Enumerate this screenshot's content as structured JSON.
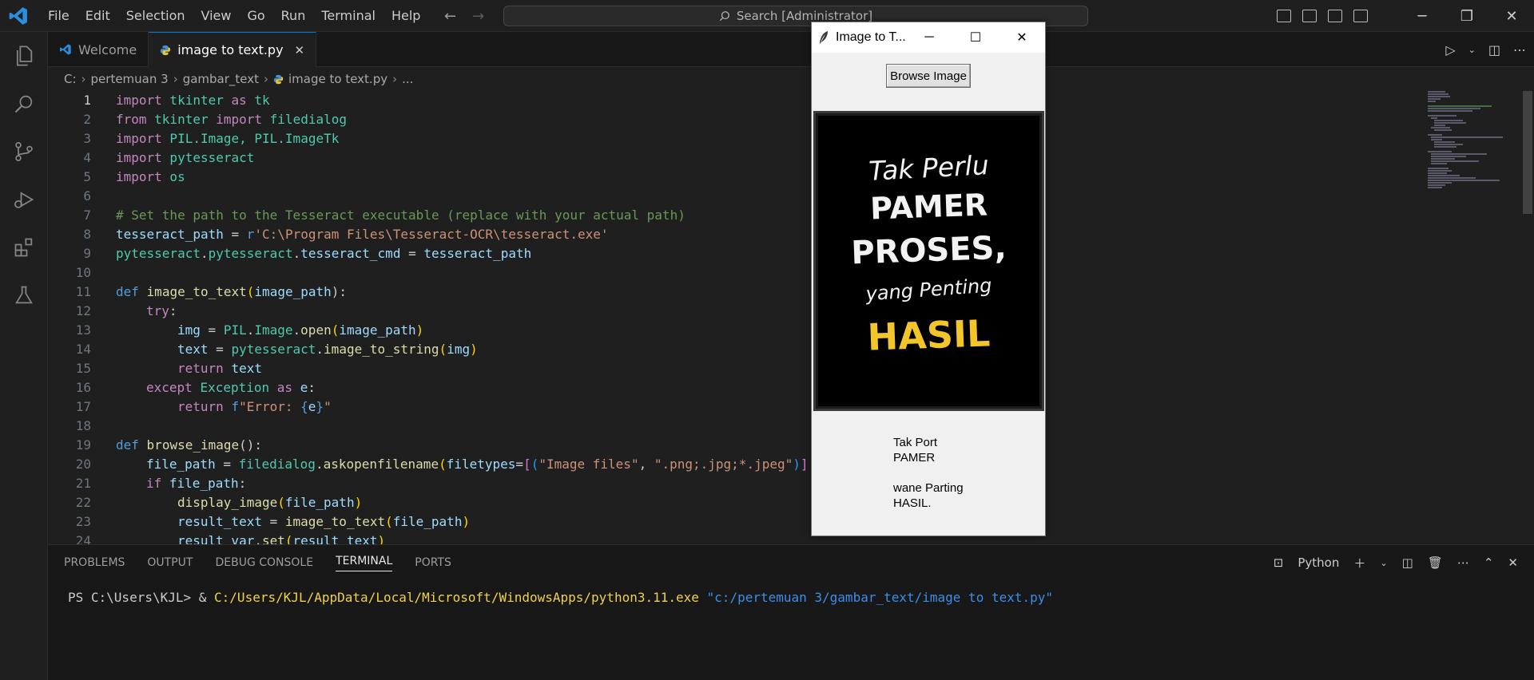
{
  "titlebar": {
    "menu": [
      "File",
      "Edit",
      "Selection",
      "View",
      "Go",
      "Run",
      "Terminal",
      "Help"
    ],
    "search": "Search [Administrator]"
  },
  "tabs": [
    {
      "label": "Welcome",
      "active": false
    },
    {
      "label": "image to text.py",
      "active": true
    }
  ],
  "breadcrumb": [
    "C:",
    "pertemuan 3",
    "gambar_text",
    "image to text.py",
    "..."
  ],
  "editor": {
    "current_line": 1,
    "lines": [
      {
        "n": "1"
      },
      {
        "n": "2"
      },
      {
        "n": "3"
      },
      {
        "n": "4"
      },
      {
        "n": "5"
      },
      {
        "n": "6"
      },
      {
        "n": "7"
      },
      {
        "n": "8"
      },
      {
        "n": "9"
      },
      {
        "n": "10"
      },
      {
        "n": "11"
      },
      {
        "n": "12"
      },
      {
        "n": "13"
      },
      {
        "n": "14"
      },
      {
        "n": "15"
      },
      {
        "n": "16"
      },
      {
        "n": "17"
      },
      {
        "n": "18"
      },
      {
        "n": "19"
      },
      {
        "n": "20"
      },
      {
        "n": "21"
      },
      {
        "n": "22"
      },
      {
        "n": "23"
      },
      {
        "n": "24"
      }
    ],
    "code": {
      "l1": [
        "import",
        " tkinter ",
        "as",
        " tk"
      ],
      "l2": [
        "from",
        " tkinter ",
        "import",
        " filedialog"
      ],
      "l3": [
        "import",
        " PIL.Image, PIL.ImageTk"
      ],
      "l4": [
        "import",
        " pytesseract"
      ],
      "l5": [
        "import",
        " os"
      ],
      "l7": "# Set the path to the Tesseract executable (replace with your actual path)",
      "l8": [
        "tesseract_path",
        " = ",
        "r",
        "'C:\\Program Files\\Tesseract-OCR\\tesseract.exe'"
      ],
      "l9": [
        "pytesseract",
        ".",
        "pytesseract",
        ".",
        "tesseract_cmd",
        " = ",
        "tesseract_path"
      ],
      "l11": [
        "def",
        " ",
        "image_to_text",
        "(",
        "image_path",
        "):"
      ],
      "l12": [
        "try",
        ":"
      ],
      "l13": [
        "img",
        " = ",
        "PIL",
        ".",
        "Image",
        ".",
        "open",
        "(",
        "image_path",
        ")"
      ],
      "l14": [
        "text",
        " = ",
        "pytesseract",
        ".",
        "image_to_string",
        "(",
        "img",
        ")"
      ],
      "l15": [
        "return",
        " ",
        "text"
      ],
      "l16": [
        "except",
        " ",
        "Exception",
        " ",
        "as",
        " ",
        "e",
        ":"
      ],
      "l17": [
        "return",
        " ",
        "f",
        "\"Error: ",
        "{",
        "e",
        "}",
        "\""
      ],
      "l19": [
        "def",
        " ",
        "browse_image",
        "():"
      ],
      "l20": [
        "file_path",
        " = ",
        "filedialog",
        ".",
        "askopenfilename",
        "(",
        "filetypes",
        "=",
        "[",
        "(",
        "\"Image files\"",
        ", ",
        "\".png;.jpg;*.jpeg\"",
        ")",
        "]"
      ],
      "l21": [
        "if",
        " ",
        "file_path",
        ":"
      ],
      "l22": [
        "display_image",
        "(",
        "file_path",
        ")"
      ],
      "l23": [
        "result_text",
        " = ",
        "image_to_text",
        "(",
        "file_path",
        ")"
      ],
      "l24": [
        "result_var",
        ".",
        "set",
        "(",
        "result_text",
        ")"
      ]
    }
  },
  "panel": {
    "tabs": [
      "PROBLEMS",
      "OUTPUT",
      "DEBUG CONSOLE",
      "TERMINAL",
      "PORTS"
    ],
    "active_tab": "TERMINAL",
    "terminal_label": "Python",
    "terminal": {
      "prompt": "PS C:\\Users\\KJL> & ",
      "exe": "C:/Users/KJL/AppData/Local/Microsoft/WindowsApps/python3.11.exe",
      "arg": " \"c:/pertemuan 3/gambar_text/image to text.py\""
    }
  },
  "tk_window": {
    "title": "Image to T...",
    "browse_button": "Browse Image",
    "image_quote": [
      "Tak Perlu",
      "PAMER",
      "PROSES,",
      "yang Penting",
      "HASIL"
    ],
    "result_lines": [
      "Tak Port",
      "PAMER",
      "",
      "wane Parting",
      "HASIL."
    ]
  },
  "colors": {
    "accent": "#0078d4",
    "background": "#1f1f1f",
    "quote_highlight": "#f2c62b"
  }
}
